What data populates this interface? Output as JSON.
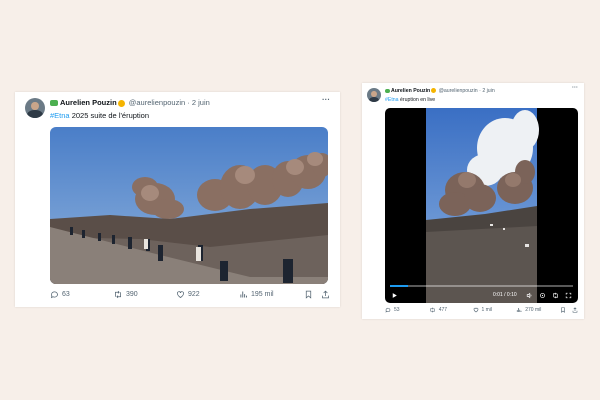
{
  "tweets": [
    {
      "display_name": "Aurelien Pouzin",
      "handle": "@aurelienpouzin",
      "separator": "·",
      "date": "2 juin",
      "hashtag": "#Etna",
      "text": " 2025 suite de l'éruption",
      "actions": {
        "replies": "63",
        "retweets": "390",
        "likes": "922",
        "views": "195 mil"
      }
    },
    {
      "display_name": "Aurelien Pouzin",
      "handle": "@aurelienpouzin",
      "separator": "·",
      "date": "2 juin",
      "hashtag": "#Etna",
      "text": " éruption en live",
      "video": {
        "time": "0:01 / 0:10",
        "progress": 0.1
      },
      "actions": {
        "replies": "53",
        "retweets": "477",
        "likes": "1 mil",
        "views": "270 mil"
      }
    }
  ],
  "colors": {
    "background": "#f7efe9",
    "accent": "#1d9bf0",
    "muted": "#536471"
  },
  "icons": [
    "more-icon",
    "reply-icon",
    "retweet-icon",
    "like-icon",
    "views-icon",
    "bookmark-icon",
    "share-icon",
    "play-icon",
    "volume-icon",
    "settings-icon",
    "retweet-video-icon",
    "fullscreen-icon"
  ]
}
